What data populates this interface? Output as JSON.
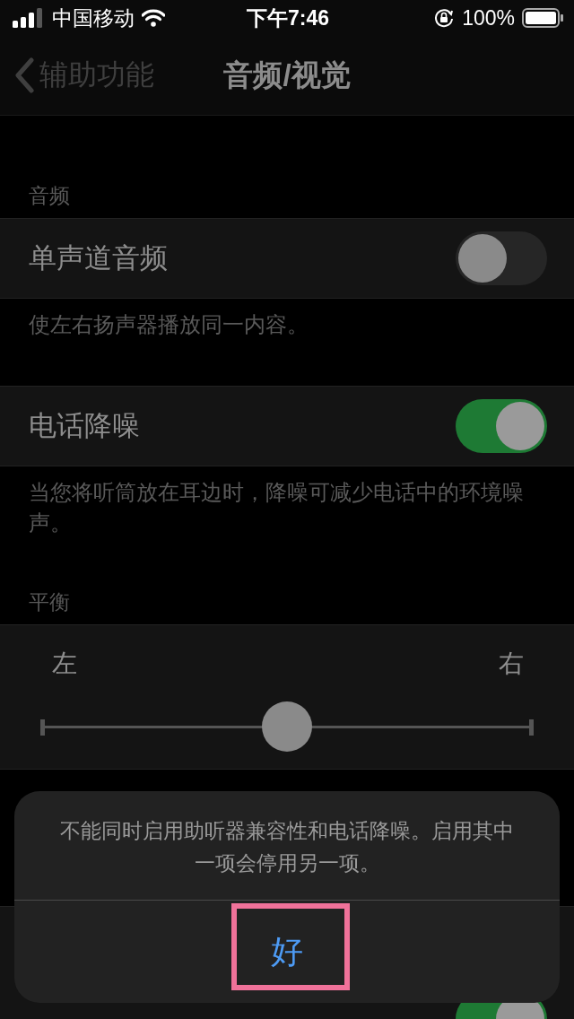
{
  "status_bar": {
    "carrier": "中国移动",
    "time": "下午7:46",
    "battery": "100%"
  },
  "nav": {
    "back": "辅助功能",
    "title": "音频/视觉"
  },
  "sections": [
    {
      "kind": "group",
      "header": "音频",
      "rows": [
        {
          "kind": "toggle",
          "label": "单声道音频",
          "on": false
        }
      ],
      "footer": "使左右扬声器播放同一内容。"
    },
    {
      "kind": "group",
      "rows": [
        {
          "kind": "toggle",
          "label": "电话降噪",
          "on": true
        }
      ],
      "footer": "当您将听筒放在耳边时，降噪可减少电话中的环境噪声。"
    },
    {
      "kind": "balance",
      "header": "平衡",
      "left": "左",
      "right": "右",
      "level": 0.5
    }
  ],
  "bottom_row": {
    "on": true
  },
  "alert": {
    "message": "不能同时启用助听器兼容性和电话降噪。启用其中一项会停用另一项。",
    "button": "好",
    "highlighted": true
  }
}
